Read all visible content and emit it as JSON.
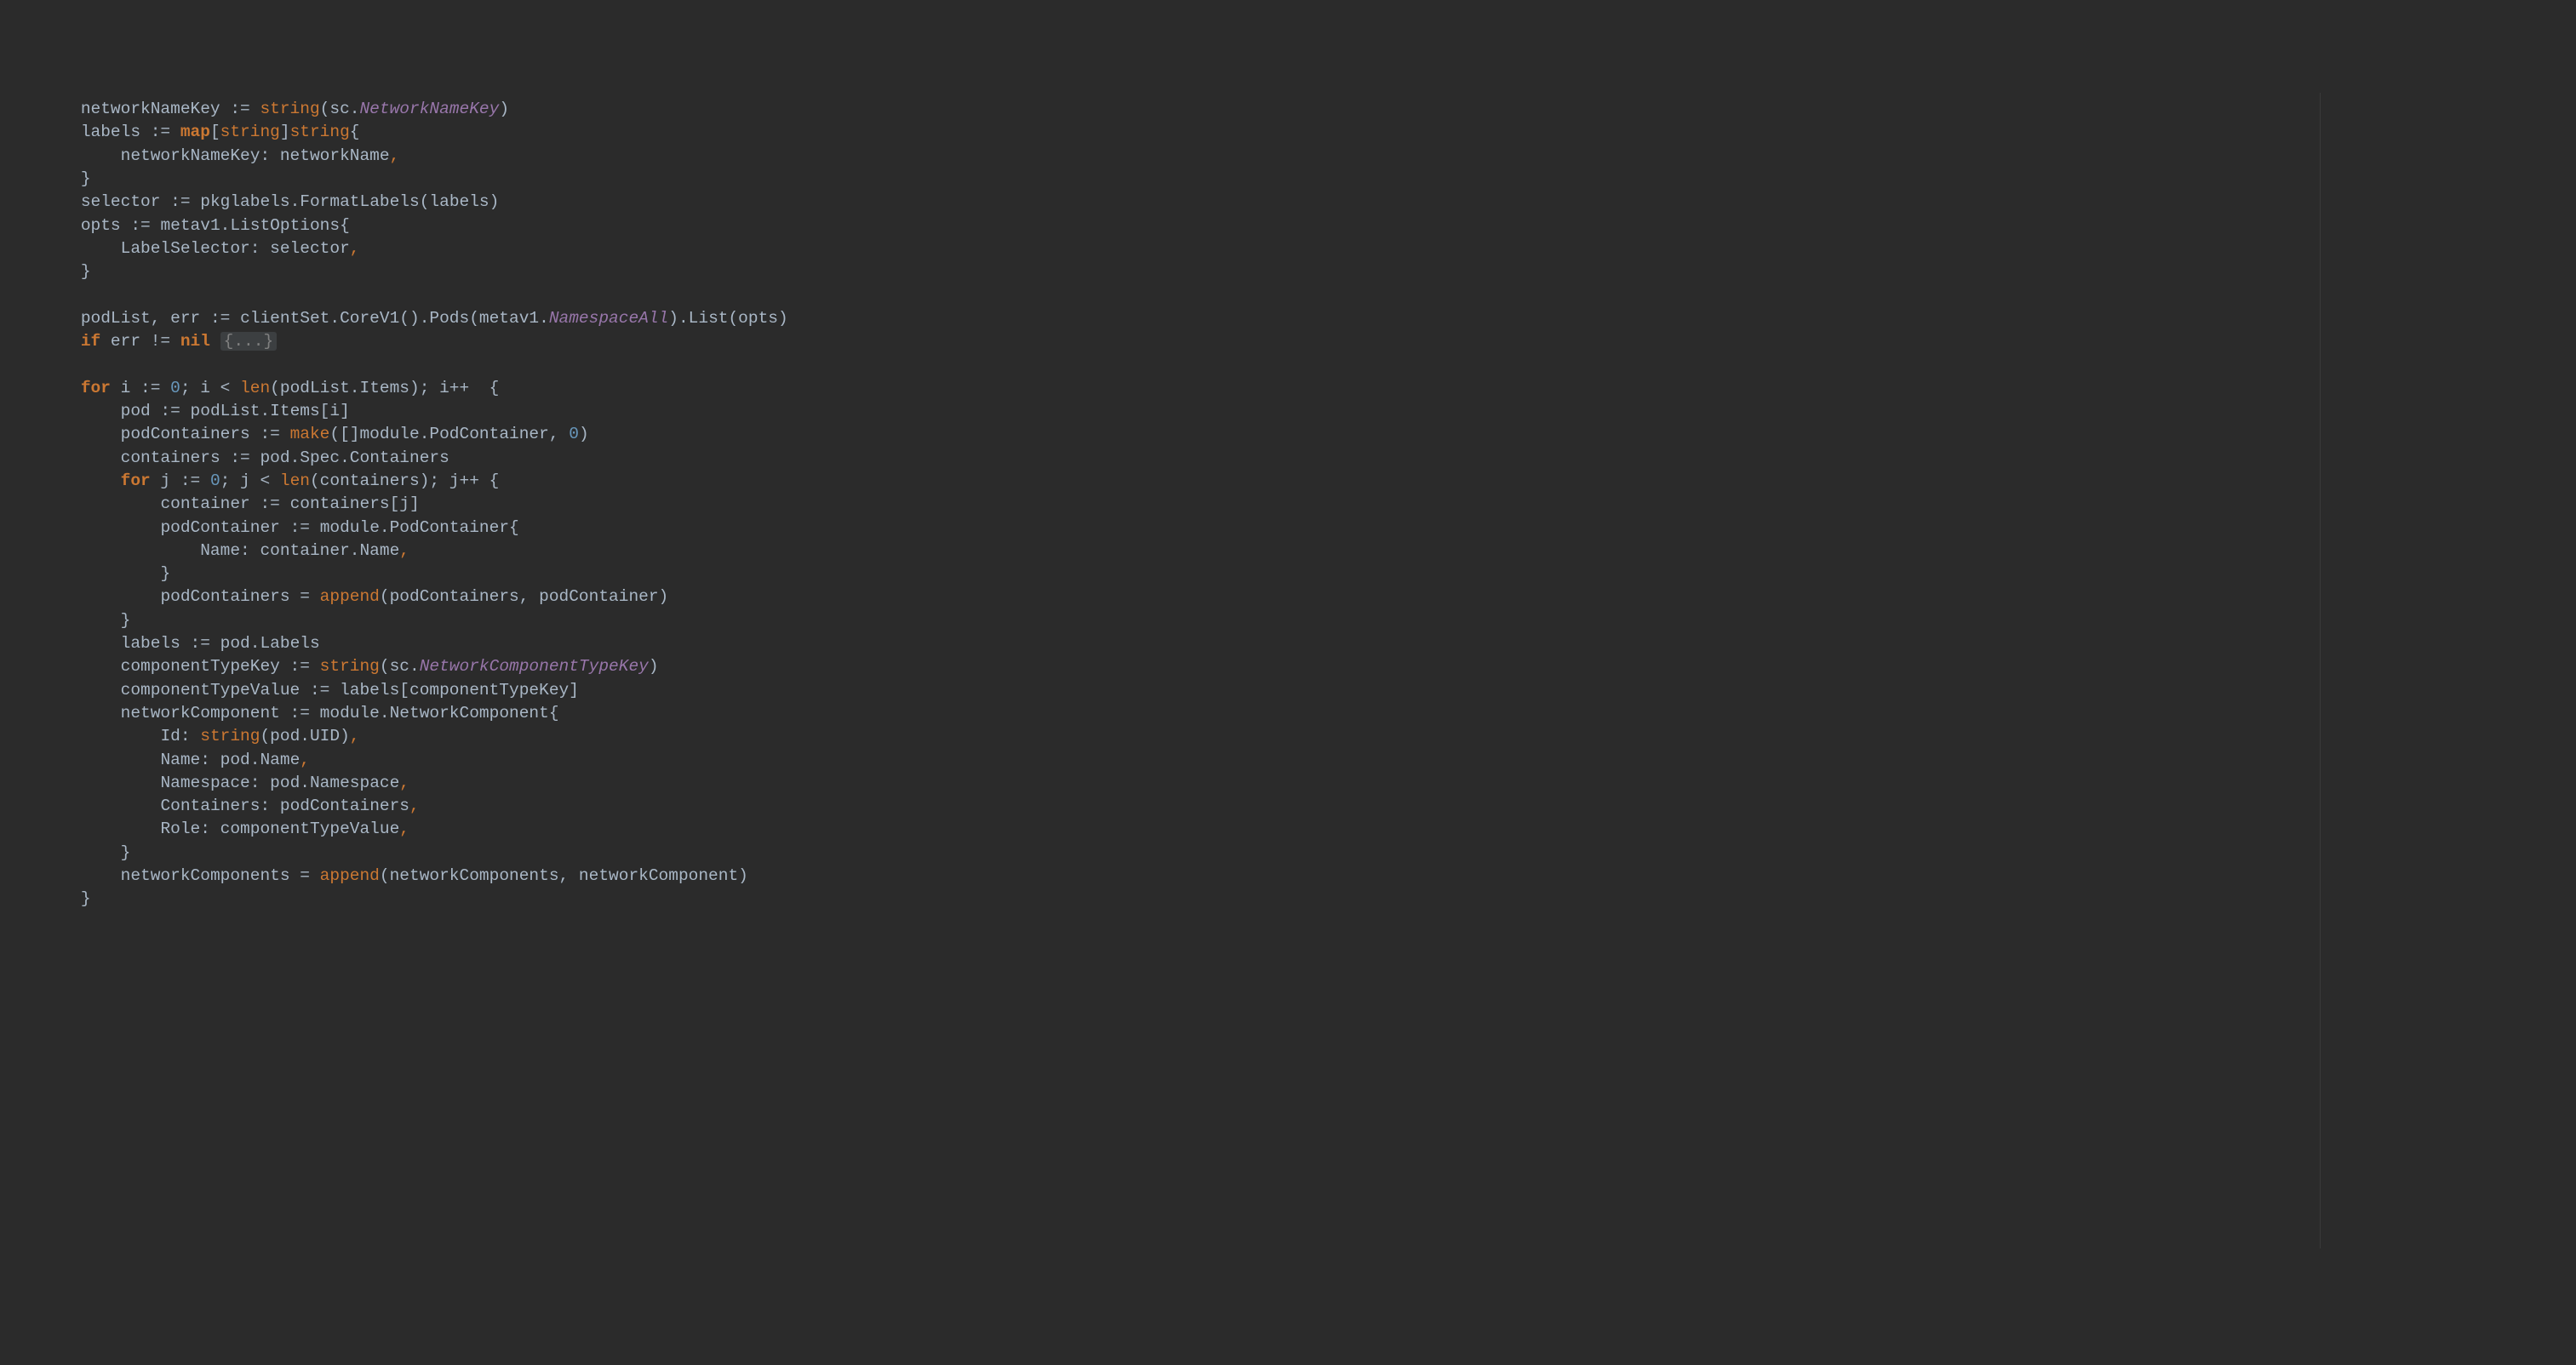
{
  "lines": {
    "l1_indent": "    ",
    "l1_networkNameKey": "networkNameKey",
    "l1_assign": " := ",
    "l1_string": "string",
    "l1_open": "(sc.",
    "l1_NetworkNameKey": "NetworkNameKey",
    "l1_close": ")",
    "l2_indent": "    ",
    "l2_labels": "labels",
    "l2_assign": " := ",
    "l2_map": "map",
    "l2_bracket1": "[",
    "l2_string1": "string",
    "l2_bracket2": "]",
    "l2_string2": "string",
    "l2_brace": "{",
    "l3_indent": "        ",
    "l3_key": "networkNameKey",
    "l3_colon": ": ",
    "l3_val": "networkName",
    "l3_comma": ",",
    "l4_indent": "    ",
    "l4_brace": "}",
    "l5_indent": "    ",
    "l5_selector": "selector",
    "l5_assign": " := ",
    "l5_pkg": "pkglabels",
    "l5_dot": ".",
    "l5_func": "FormatLabels",
    "l5_args": "(labels)",
    "l6_indent": "    ",
    "l6_opts": "opts",
    "l6_assign": " := ",
    "l6_metav1": "metav1",
    "l6_dot": ".",
    "l6_ListOptions": "ListOptions",
    "l6_brace": "{",
    "l7_indent": "        ",
    "l7_LabelSelector": "LabelSelector",
    "l7_colon": ": ",
    "l7_selector": "selector",
    "l7_comma": ",",
    "l8_indent": "    ",
    "l8_brace": "}",
    "l9_blank": "",
    "l10_indent": "    ",
    "l10_podList": "podList",
    "l10_comma": ", ",
    "l10_err": "err",
    "l10_assign": " := ",
    "l10_call": "clientSet.CoreV1().Pods(metav1.",
    "l10_NamespaceAll": "NamespaceAll",
    "l10_close": ").List(opts)",
    "l11_indent": "    ",
    "l11_if": "if",
    "l11_cond": " err != ",
    "l11_nil": "nil",
    "l11_space": " ",
    "l11_fold": "{...}",
    "l12_blank": "",
    "l13_indent": "    ",
    "l13_for": "for",
    "l13_i": " i := ",
    "l13_zero": "0",
    "l13_semi1": "; i < ",
    "l13_len": "len",
    "l13_lenarg": "(podList.Items); i++  {",
    "l14_indent": "        ",
    "l14_pod": "pod",
    "l14_assign": " := ",
    "l14_rhs": "podList.Items[i]",
    "l15_indent": "        ",
    "l15_podContainers": "podContainers",
    "l15_assign": " := ",
    "l15_make": "make",
    "l15_open": "([]module.",
    "l15_PodContainer": "PodContainer",
    "l15_comma": ", ",
    "l15_zero": "0",
    "l15_close": ")",
    "l16_indent": "        ",
    "l16_containers": "containers",
    "l16_assign": " := ",
    "l16_rhs": "pod.Spec.Containers",
    "l17_indent": "        ",
    "l17_for": "for",
    "l17_j": " j := ",
    "l17_zero": "0",
    "l17_semi": "; j < ",
    "l17_len": "len",
    "l17_args": "(containers); j++ {",
    "l18_indent": "            ",
    "l18_container": "container",
    "l18_assign": " := ",
    "l18_rhs": "containers[j]",
    "l19_indent": "            ",
    "l19_podContainer": "podContainer",
    "l19_assign": " := ",
    "l19_module": "module.",
    "l19_PodContainer": "PodContainer",
    "l19_brace": "{",
    "l20_indent": "                ",
    "l20_Name": "Name",
    "l20_colon": ": ",
    "l20_val": "container.Name",
    "l20_comma": ",",
    "l21_indent": "            ",
    "l21_brace": "}",
    "l22_indent": "            ",
    "l22_lhs": "podContainers",
    "l22_eq": " = ",
    "l22_append": "append",
    "l22_args": "(podContainers, podContainer)",
    "l23_indent": "        ",
    "l23_brace": "}",
    "l24_indent": "        ",
    "l24_labels": "labels",
    "l24_assign": " := ",
    "l24_rhs": "pod.Labels",
    "l25_indent": "        ",
    "l25_componentTypeKey": "componentTypeKey",
    "l25_assign": " := ",
    "l25_string": "string",
    "l25_open": "(sc.",
    "l25_NetworkComponentTypeKey": "NetworkComponentTypeKey",
    "l25_close": ")",
    "l26_indent": "        ",
    "l26_componentTypeValue": "componentTypeValue",
    "l26_assign": " := ",
    "l26_rhs": "labels[componentTypeKey]",
    "l27_indent": "        ",
    "l27_networkComponent": "networkComponent",
    "l27_assign": " := ",
    "l27_module": "module.",
    "l27_NetworkComponent": "NetworkComponent",
    "l27_brace": "{",
    "l28_indent": "            ",
    "l28_Id": "Id",
    "l28_colon": ": ",
    "l28_string": "string",
    "l28_args": "(pod.UID)",
    "l28_comma": ",",
    "l29_indent": "            ",
    "l29_Name": "Name",
    "l29_colon": ": ",
    "l29_val": "pod.Name",
    "l29_comma": ",",
    "l30_indent": "            ",
    "l30_Namespace": "Namespace",
    "l30_colon": ": ",
    "l30_val": "pod.Namespace",
    "l30_comma": ",",
    "l31_indent": "            ",
    "l31_Containers": "Containers",
    "l31_colon": ": ",
    "l31_val": "podContainers",
    "l31_comma": ",",
    "l32_indent": "            ",
    "l32_Role": "Role",
    "l32_colon": ": ",
    "l32_val": "componentTypeValue",
    "l32_comma": ",",
    "l33_indent": "        ",
    "l33_brace": "}",
    "l34_indent": "        ",
    "l34_lhs": "networkComponents",
    "l34_eq": " = ",
    "l34_append": "append",
    "l34_args": "(networkComponents, networkComponent)",
    "l35_indent": "    ",
    "l35_brace": "}"
  }
}
